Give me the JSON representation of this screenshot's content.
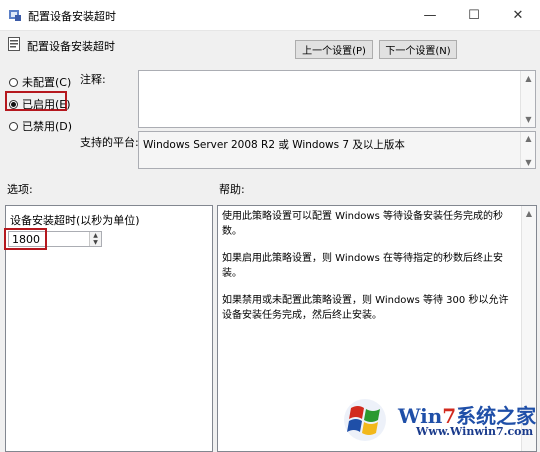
{
  "window": {
    "title": "配置设备安装超时",
    "minimize": "—",
    "maximize": "☐",
    "close": "✕"
  },
  "header": {
    "policy_title": "配置设备安装超时",
    "prev_button": "上一个设置(P)",
    "next_button": "下一个设置(N)"
  },
  "state": {
    "options": [
      {
        "label": "未配置(C)",
        "selected": false
      },
      {
        "label": "已启用(E)",
        "selected": true
      },
      {
        "label": "已禁用(D)",
        "selected": false
      }
    ]
  },
  "comment": {
    "label": "注释:",
    "value": ""
  },
  "platform": {
    "label": "支持的平台:",
    "value": "Windows Server 2008 R2 或 Windows 7 及以上版本"
  },
  "options_section": {
    "label": "选项:",
    "timeout_label": "设备安装超时(以秒为单位)",
    "timeout_value": "1800"
  },
  "help_section": {
    "label": "帮助:",
    "paragraphs": [
      "使用此策略设置可以配置 Windows 等待设备安装任务完成的秒数。",
      "如果启用此策略设置，则 Windows 在等待指定的秒数后终止安装。",
      "如果禁用或未配置此策略设置，则 Windows 等待 300 秒以允许设备安装任务完成，然后终止安装。"
    ]
  },
  "watermark": {
    "text_part1": "Win",
    "text_part2": "7",
    "text_part3": "系统之家",
    "url": "Www.Winwin7.com",
    "colors": {
      "blue": "#1f4fa8",
      "red": "#d22a1e",
      "green": "#2b9a2f",
      "yellow": "#f2b81b"
    }
  },
  "colors": {
    "highlight_border": "#b5181e",
    "dialog_bg": "#f0f0f0"
  }
}
